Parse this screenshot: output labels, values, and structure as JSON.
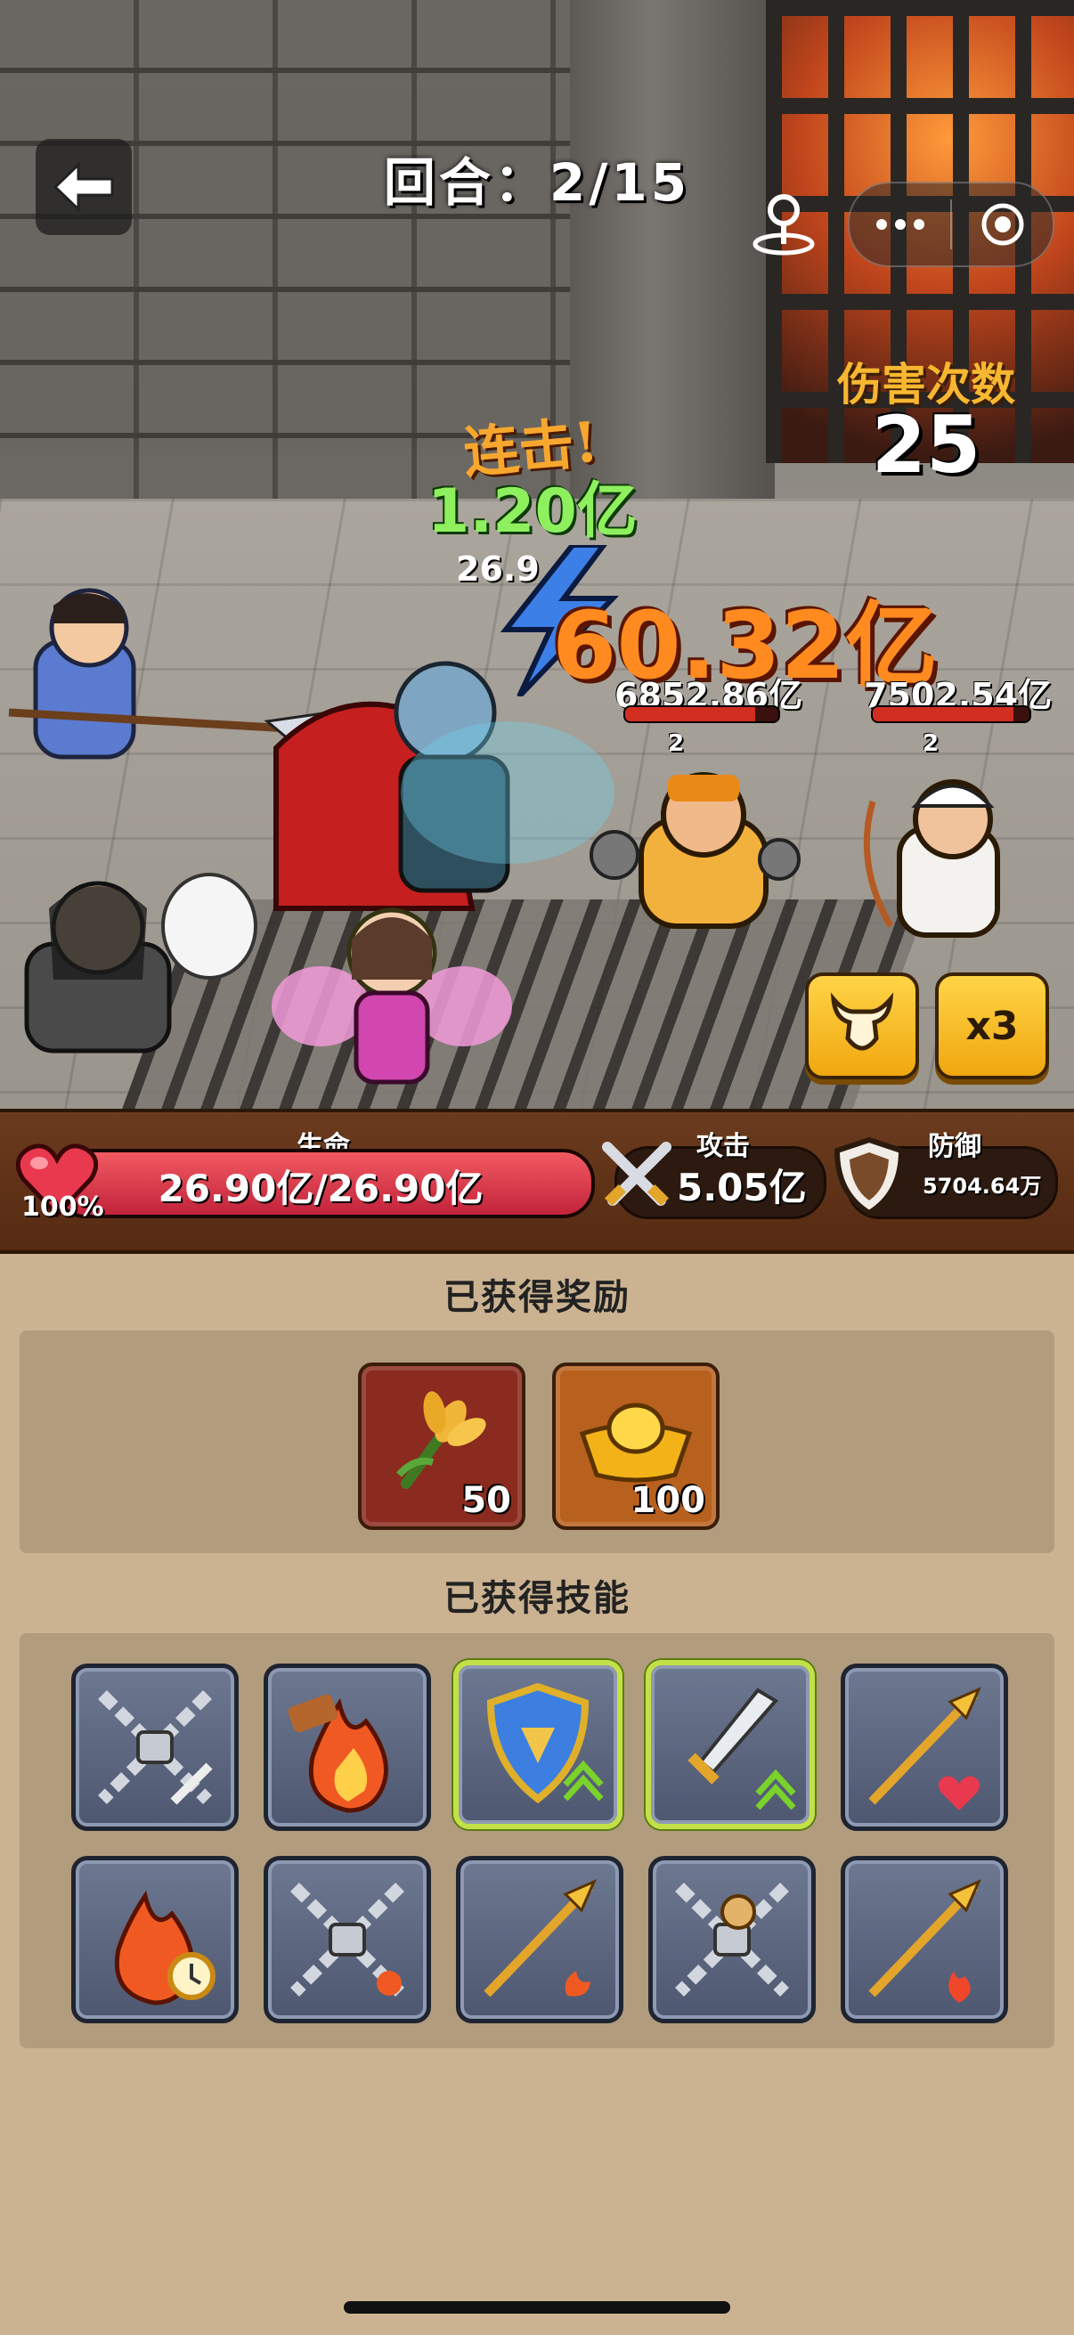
{
  "header": {
    "round_label": "回合：2/15",
    "damage_count_label": "伤害次数",
    "damage_count": "25"
  },
  "battle": {
    "combo_text": "连击!",
    "combo_damage": "1.20亿",
    "big_damage": "60.32亿",
    "partial_hp": "26.9",
    "enemies": [
      {
        "hp": "6852.86亿",
        "level": "2",
        "hp_fraction": 0.85
      },
      {
        "hp": "7502.54亿",
        "level": "2",
        "hp_fraction": 0.9
      }
    ],
    "speed_label": "x3"
  },
  "stats": {
    "hp_label": "生命",
    "hp_value": "26.90亿/26.90亿",
    "hp_percent": "100%",
    "hp_fraction": 1.0,
    "attack_label": "攻击",
    "attack_value": "5.05亿",
    "defense_label": "防御",
    "defense_value": "5704.64万"
  },
  "rewards": {
    "title": "已获得奖励",
    "items": [
      {
        "icon": "grain-icon",
        "qty": "50"
      },
      {
        "icon": "gold-ingot-icon",
        "qty": "100"
      }
    ]
  },
  "skills": {
    "title": "已获得技能",
    "items": [
      {
        "icon": "chain-lock-sword-icon",
        "highlighted": false
      },
      {
        "icon": "fire-hammer-icon",
        "highlighted": false
      },
      {
        "icon": "shield-upgrade-icon",
        "highlighted": true
      },
      {
        "icon": "sword-upgrade-icon",
        "highlighted": true
      },
      {
        "icon": "spear-heart-icon",
        "highlighted": false
      },
      {
        "icon": "fire-clock-icon",
        "highlighted": false
      },
      {
        "icon": "chain-lock-fire-icon",
        "highlighted": false
      },
      {
        "icon": "spear-fire-icon",
        "highlighted": false
      },
      {
        "icon": "chain-lock-arrow-icon",
        "highlighted": false
      },
      {
        "icon": "spear-flame-icon",
        "highlighted": false
      }
    ]
  },
  "colors": {
    "stats_bg": "#6b3b1d",
    "hp_fill": "#d23046",
    "panel_bg": "#b29c7e",
    "page_bg": "#cbb391",
    "highlight": "#c2e146",
    "gold_button": "#f0a70f"
  }
}
